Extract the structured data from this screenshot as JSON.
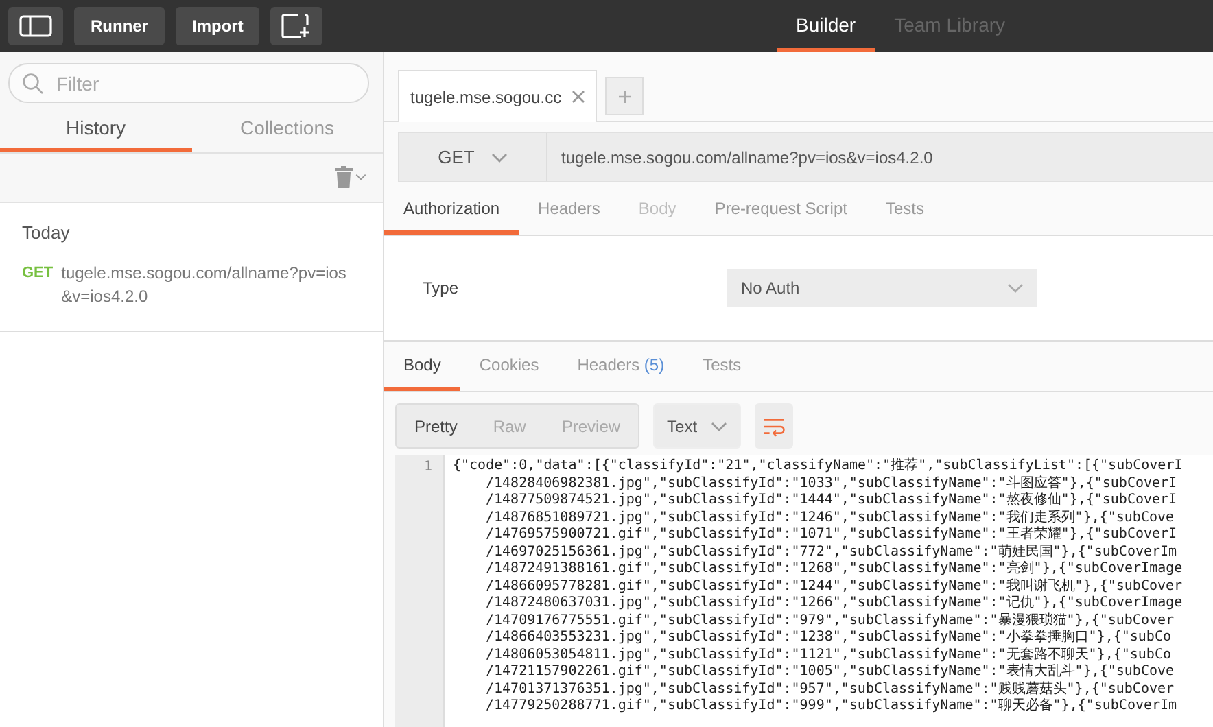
{
  "header": {
    "buttons": [
      {
        "label": "Runner"
      },
      {
        "label": "Import"
      }
    ],
    "tabs": [
      {
        "label": "Builder",
        "selected": true
      },
      {
        "label": "Team Library",
        "selected": false
      }
    ]
  },
  "sidebar": {
    "search": {
      "placeholder": "Filter"
    },
    "tabs": [
      {
        "label": "History",
        "selected": true
      },
      {
        "label": "Collections",
        "selected": false
      }
    ],
    "groups": [
      {
        "title": "Today",
        "items": [
          {
            "method": "GET",
            "url": "tugele.mse.sogou.com/allname?pv=ios&v=ios4.2.0"
          }
        ]
      }
    ]
  },
  "request": {
    "tab": {
      "title": "tugele.mse.sogou.cc"
    },
    "method": "GET",
    "url": "tugele.mse.sogou.com/allname?pv=ios&v=ios4.2.0",
    "tabs": [
      {
        "label": "Authorization",
        "selected": true,
        "disabled": false
      },
      {
        "label": "Headers",
        "selected": false,
        "disabled": false
      },
      {
        "label": "Body",
        "selected": false,
        "disabled": true
      },
      {
        "label": "Pre-request Script",
        "selected": false,
        "disabled": false
      },
      {
        "label": "Tests",
        "selected": false,
        "disabled": false
      }
    ],
    "auth": {
      "label": "Type",
      "value": "No Auth"
    }
  },
  "response": {
    "tabs": [
      {
        "label": "Body",
        "selected": true
      },
      {
        "label": "Cookies",
        "selected": false
      },
      {
        "label": "Headers",
        "count": "(5)",
        "selected": false
      },
      {
        "label": "Tests",
        "selected": false
      }
    ],
    "views": [
      {
        "label": "Pretty",
        "selected": true
      },
      {
        "label": "Raw",
        "selected": false
      },
      {
        "label": "Preview",
        "selected": false
      }
    ],
    "format": "Text",
    "line_number": "1",
    "lines": [
      "{\"code\":0,\"data\":[{\"classifyId\":\"21\",\"classifyName\":\"推荐\",\"subClassifyList\":[{\"subCoverI",
      "/14828406982381.jpg\",\"subClassifyId\":\"1033\",\"subClassifyName\":\"斗图应答\"},{\"subCoverI",
      "/14877509874521.jpg\",\"subClassifyId\":\"1444\",\"subClassifyName\":\"熬夜修仙\"},{\"subCoverI",
      "/14876851089721.jpg\",\"subClassifyId\":\"1246\",\"subClassifyName\":\"我们走系列\"},{\"subCove",
      "/14769575900721.gif\",\"subClassifyId\":\"1071\",\"subClassifyName\":\"王者荣耀\"},{\"subCoverI",
      "/14697025156361.jpg\",\"subClassifyId\":\"772\",\"subClassifyName\":\"萌娃民国\"},{\"subCoverIm",
      "/14872491388161.gif\",\"subClassifyId\":\"1268\",\"subClassifyName\":\"亮剑\"},{\"subCoverImage",
      "/14866095778281.gif\",\"subClassifyId\":\"1244\",\"subClassifyName\":\"我叫谢飞机\"},{\"subCover",
      "/14872480637031.jpg\",\"subClassifyId\":\"1266\",\"subClassifyName\":\"记仇\"},{\"subCoverImage",
      "/14709176775551.gif\",\"subClassifyId\":\"979\",\"subClassifyName\":\"暴漫猥琐猫\"},{\"subCover",
      "/14866403553231.jpg\",\"subClassifyId\":\"1238\",\"subClassifyName\":\"小拳拳捶胸口\"},{\"subCo",
      "/14806053054811.jpg\",\"subClassifyId\":\"1121\",\"subClassifyName\":\"无套路不聊天\"},{\"subCo",
      "/14721157902261.gif\",\"subClassifyId\":\"1005\",\"subClassifyName\":\"表情大乱斗\"},{\"subCove",
      "/14701371376351.jpg\",\"subClassifyId\":\"957\",\"subClassifyName\":\"贱贱蘑菇头\"},{\"subCover",
      "/14779250288771.gif\",\"subClassifyId\":\"999\",\"subClassifyName\":\"聊天必备\"},{\"subCoverIm"
    ]
  }
}
